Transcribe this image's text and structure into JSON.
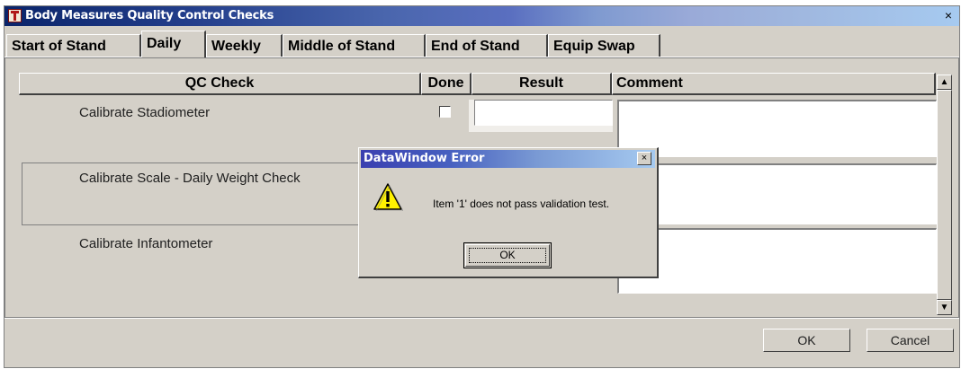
{
  "window": {
    "title": "Body Measures Quality Control Checks",
    "close_glyph": "×",
    "icon": "app-t-icon"
  },
  "tabs": [
    {
      "label": "Start of Stand",
      "active": false
    },
    {
      "label": "Daily",
      "active": true
    },
    {
      "label": "Weekly",
      "active": false
    },
    {
      "label": "Middle of Stand",
      "active": false
    },
    {
      "label": "End of Stand",
      "active": false
    },
    {
      "label": "Equip Swap",
      "active": false
    }
  ],
  "table": {
    "headers": {
      "qc_check": "QC Check",
      "done": "Done",
      "result": "Result",
      "comment": "Comment"
    },
    "rows": [
      {
        "qc_check": "Calibrate Stadiometer",
        "done": false,
        "result": "",
        "comment": ""
      },
      {
        "qc_check": "Calibrate Scale - Daily Weight Check",
        "done": false,
        "result": "",
        "comment": ""
      },
      {
        "qc_check": "Calibrate Infantometer",
        "done": false,
        "result": "",
        "comment": ""
      }
    ]
  },
  "scrollbar": {
    "up_glyph": "▲",
    "down_glyph": "▼"
  },
  "footer": {
    "ok_label": "OK",
    "cancel_label": "Cancel"
  },
  "dialog": {
    "title": "DataWindow Error",
    "close_glyph": "×",
    "message": "Item '1' does not pass validation test.",
    "ok_label": "OK",
    "icon": "warning-icon"
  },
  "colors": {
    "face": "#d4d0c8",
    "title_start": "#0a246a",
    "title_end": "#a6caf0"
  }
}
